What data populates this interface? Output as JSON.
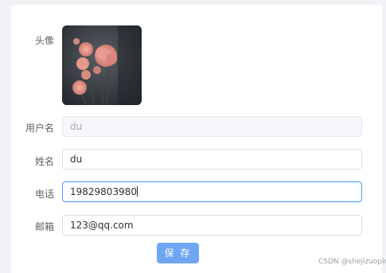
{
  "form": {
    "avatar_label": "头像",
    "username_label": "用户名",
    "username_value": "du",
    "name_label": "姓名",
    "name_value": "du",
    "phone_label": "电话",
    "phone_value": "19829803980",
    "email_label": "邮箱",
    "email_value": "123@qq.com",
    "save_label": "保 存"
  },
  "watermark": "CSDN @shejizuopin",
  "colors": {
    "accent": "#409eff",
    "button": "#6fa6f3",
    "disabled_bg": "#f5f7fa"
  }
}
